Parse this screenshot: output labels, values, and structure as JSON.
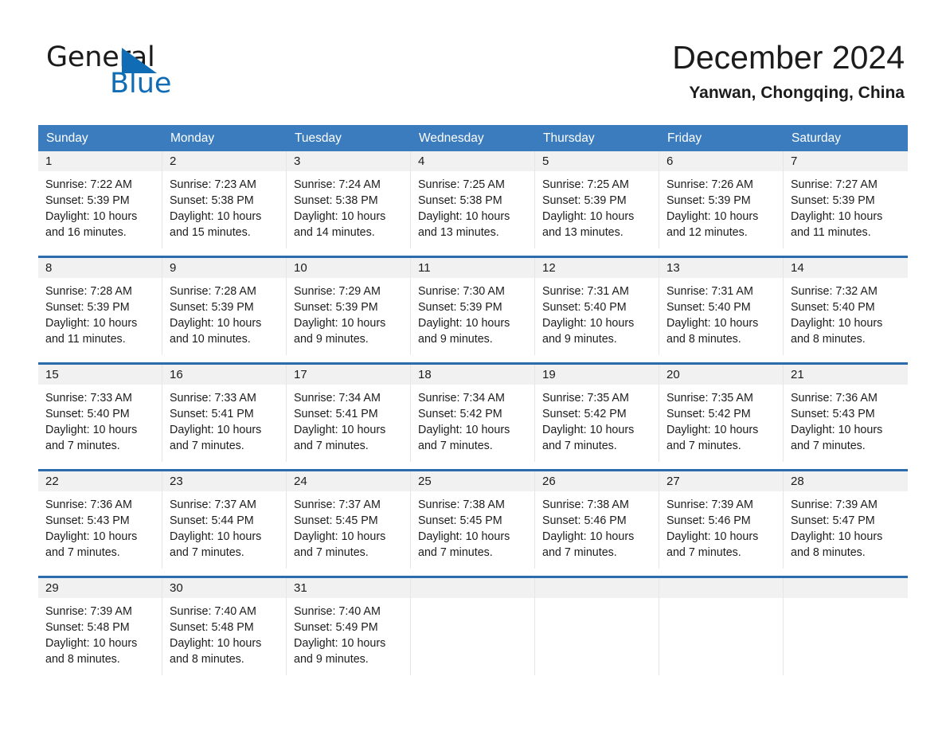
{
  "brand": {
    "name_part1": "General",
    "name_part2": "Blue",
    "accent_color": "#0f6cb5"
  },
  "header": {
    "title": "December 2024",
    "location": "Yanwan, Chongqing, China"
  },
  "calendar": {
    "header_color": "#3a7cbe",
    "row_rule_color": "#2c6cad",
    "date_band_color": "#f1f1f1",
    "weekdays": [
      "Sunday",
      "Monday",
      "Tuesday",
      "Wednesday",
      "Thursday",
      "Friday",
      "Saturday"
    ],
    "weeks": [
      [
        {
          "date": "1",
          "sunrise": "Sunrise: 7:22 AM",
          "sunset": "Sunset: 5:39 PM",
          "daylight_1": "Daylight: 10 hours",
          "daylight_2": "and 16 minutes."
        },
        {
          "date": "2",
          "sunrise": "Sunrise: 7:23 AM",
          "sunset": "Sunset: 5:38 PM",
          "daylight_1": "Daylight: 10 hours",
          "daylight_2": "and 15 minutes."
        },
        {
          "date": "3",
          "sunrise": "Sunrise: 7:24 AM",
          "sunset": "Sunset: 5:38 PM",
          "daylight_1": "Daylight: 10 hours",
          "daylight_2": "and 14 minutes."
        },
        {
          "date": "4",
          "sunrise": "Sunrise: 7:25 AM",
          "sunset": "Sunset: 5:38 PM",
          "daylight_1": "Daylight: 10 hours",
          "daylight_2": "and 13 minutes."
        },
        {
          "date": "5",
          "sunrise": "Sunrise: 7:25 AM",
          "sunset": "Sunset: 5:39 PM",
          "daylight_1": "Daylight: 10 hours",
          "daylight_2": "and 13 minutes."
        },
        {
          "date": "6",
          "sunrise": "Sunrise: 7:26 AM",
          "sunset": "Sunset: 5:39 PM",
          "daylight_1": "Daylight: 10 hours",
          "daylight_2": "and 12 minutes."
        },
        {
          "date": "7",
          "sunrise": "Sunrise: 7:27 AM",
          "sunset": "Sunset: 5:39 PM",
          "daylight_1": "Daylight: 10 hours",
          "daylight_2": "and 11 minutes."
        }
      ],
      [
        {
          "date": "8",
          "sunrise": "Sunrise: 7:28 AM",
          "sunset": "Sunset: 5:39 PM",
          "daylight_1": "Daylight: 10 hours",
          "daylight_2": "and 11 minutes."
        },
        {
          "date": "9",
          "sunrise": "Sunrise: 7:28 AM",
          "sunset": "Sunset: 5:39 PM",
          "daylight_1": "Daylight: 10 hours",
          "daylight_2": "and 10 minutes."
        },
        {
          "date": "10",
          "sunrise": "Sunrise: 7:29 AM",
          "sunset": "Sunset: 5:39 PM",
          "daylight_1": "Daylight: 10 hours",
          "daylight_2": "and 9 minutes."
        },
        {
          "date": "11",
          "sunrise": "Sunrise: 7:30 AM",
          "sunset": "Sunset: 5:39 PM",
          "daylight_1": "Daylight: 10 hours",
          "daylight_2": "and 9 minutes."
        },
        {
          "date": "12",
          "sunrise": "Sunrise: 7:31 AM",
          "sunset": "Sunset: 5:40 PM",
          "daylight_1": "Daylight: 10 hours",
          "daylight_2": "and 9 minutes."
        },
        {
          "date": "13",
          "sunrise": "Sunrise: 7:31 AM",
          "sunset": "Sunset: 5:40 PM",
          "daylight_1": "Daylight: 10 hours",
          "daylight_2": "and 8 minutes."
        },
        {
          "date": "14",
          "sunrise": "Sunrise: 7:32 AM",
          "sunset": "Sunset: 5:40 PM",
          "daylight_1": "Daylight: 10 hours",
          "daylight_2": "and 8 minutes."
        }
      ],
      [
        {
          "date": "15",
          "sunrise": "Sunrise: 7:33 AM",
          "sunset": "Sunset: 5:40 PM",
          "daylight_1": "Daylight: 10 hours",
          "daylight_2": "and 7 minutes."
        },
        {
          "date": "16",
          "sunrise": "Sunrise: 7:33 AM",
          "sunset": "Sunset: 5:41 PM",
          "daylight_1": "Daylight: 10 hours",
          "daylight_2": "and 7 minutes."
        },
        {
          "date": "17",
          "sunrise": "Sunrise: 7:34 AM",
          "sunset": "Sunset: 5:41 PM",
          "daylight_1": "Daylight: 10 hours",
          "daylight_2": "and 7 minutes."
        },
        {
          "date": "18",
          "sunrise": "Sunrise: 7:34 AM",
          "sunset": "Sunset: 5:42 PM",
          "daylight_1": "Daylight: 10 hours",
          "daylight_2": "and 7 minutes."
        },
        {
          "date": "19",
          "sunrise": "Sunrise: 7:35 AM",
          "sunset": "Sunset: 5:42 PM",
          "daylight_1": "Daylight: 10 hours",
          "daylight_2": "and 7 minutes."
        },
        {
          "date": "20",
          "sunrise": "Sunrise: 7:35 AM",
          "sunset": "Sunset: 5:42 PM",
          "daylight_1": "Daylight: 10 hours",
          "daylight_2": "and 7 minutes."
        },
        {
          "date": "21",
          "sunrise": "Sunrise: 7:36 AM",
          "sunset": "Sunset: 5:43 PM",
          "daylight_1": "Daylight: 10 hours",
          "daylight_2": "and 7 minutes."
        }
      ],
      [
        {
          "date": "22",
          "sunrise": "Sunrise: 7:36 AM",
          "sunset": "Sunset: 5:43 PM",
          "daylight_1": "Daylight: 10 hours",
          "daylight_2": "and 7 minutes."
        },
        {
          "date": "23",
          "sunrise": "Sunrise: 7:37 AM",
          "sunset": "Sunset: 5:44 PM",
          "daylight_1": "Daylight: 10 hours",
          "daylight_2": "and 7 minutes."
        },
        {
          "date": "24",
          "sunrise": "Sunrise: 7:37 AM",
          "sunset": "Sunset: 5:45 PM",
          "daylight_1": "Daylight: 10 hours",
          "daylight_2": "and 7 minutes."
        },
        {
          "date": "25",
          "sunrise": "Sunrise: 7:38 AM",
          "sunset": "Sunset: 5:45 PM",
          "daylight_1": "Daylight: 10 hours",
          "daylight_2": "and 7 minutes."
        },
        {
          "date": "26",
          "sunrise": "Sunrise: 7:38 AM",
          "sunset": "Sunset: 5:46 PM",
          "daylight_1": "Daylight: 10 hours",
          "daylight_2": "and 7 minutes."
        },
        {
          "date": "27",
          "sunrise": "Sunrise: 7:39 AM",
          "sunset": "Sunset: 5:46 PM",
          "daylight_1": "Daylight: 10 hours",
          "daylight_2": "and 7 minutes."
        },
        {
          "date": "28",
          "sunrise": "Sunrise: 7:39 AM",
          "sunset": "Sunset: 5:47 PM",
          "daylight_1": "Daylight: 10 hours",
          "daylight_2": "and 8 minutes."
        }
      ],
      [
        {
          "date": "29",
          "sunrise": "Sunrise: 7:39 AM",
          "sunset": "Sunset: 5:48 PM",
          "daylight_1": "Daylight: 10 hours",
          "daylight_2": "and 8 minutes."
        },
        {
          "date": "30",
          "sunrise": "Sunrise: 7:40 AM",
          "sunset": "Sunset: 5:48 PM",
          "daylight_1": "Daylight: 10 hours",
          "daylight_2": "and 8 minutes."
        },
        {
          "date": "31",
          "sunrise": "Sunrise: 7:40 AM",
          "sunset": "Sunset: 5:49 PM",
          "daylight_1": "Daylight: 10 hours",
          "daylight_2": "and 9 minutes."
        },
        {
          "date": "",
          "sunrise": "",
          "sunset": "",
          "daylight_1": "",
          "daylight_2": ""
        },
        {
          "date": "",
          "sunrise": "",
          "sunset": "",
          "daylight_1": "",
          "daylight_2": ""
        },
        {
          "date": "",
          "sunrise": "",
          "sunset": "",
          "daylight_1": "",
          "daylight_2": ""
        },
        {
          "date": "",
          "sunrise": "",
          "sunset": "",
          "daylight_1": "",
          "daylight_2": ""
        }
      ]
    ]
  }
}
